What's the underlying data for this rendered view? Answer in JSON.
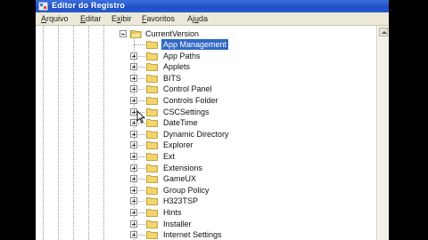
{
  "window": {
    "title": "Editor do Registro"
  },
  "menu": [
    {
      "label": "Arquivo",
      "key": "A",
      "rest": "rquivo"
    },
    {
      "label": "Editar",
      "key": "E",
      "rest": "ditar"
    },
    {
      "label": "Exibir",
      "key": "x",
      "first": "E",
      "rest": "ibir"
    },
    {
      "label": "Favoritos",
      "key": "F",
      "rest": "avoritos"
    },
    {
      "label": "Ajuda",
      "key": "u",
      "first": "Aj",
      "rest": "da"
    }
  ],
  "tree": {
    "parent": "CurrentVersion",
    "children": [
      {
        "label": "App Management",
        "selected": true
      },
      {
        "label": "App Paths"
      },
      {
        "label": "Applets"
      },
      {
        "label": "BITS"
      },
      {
        "label": "Control Panel"
      },
      {
        "label": "Controls Folder"
      },
      {
        "label": "CSCSettings"
      },
      {
        "label": "DateTime"
      },
      {
        "label": "Dynamic Directory"
      },
      {
        "label": "Explorer"
      },
      {
        "label": "Ext"
      },
      {
        "label": "Extensions"
      },
      {
        "label": "GameUX"
      },
      {
        "label": "Group Policy"
      },
      {
        "label": "H323TSP"
      },
      {
        "label": "Hints"
      },
      {
        "label": "Installer"
      },
      {
        "label": "Internet Settings"
      }
    ]
  },
  "colors": {
    "selection": "#316ac5",
    "titlebar": "#2a5bd0",
    "folder": "#f2d66b"
  },
  "icons": {
    "folder": "folder-icon",
    "expander": "plus-box-icon",
    "app": "registry-editor-icon"
  }
}
